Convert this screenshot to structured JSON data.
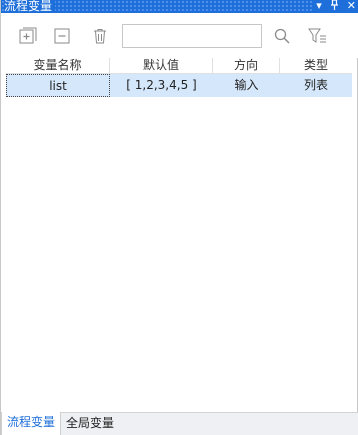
{
  "panel": {
    "title": "流程变量"
  },
  "titlebar_icons": [
    {
      "name": "dropdown-icon",
      "glyph": "▾"
    },
    {
      "name": "pin-icon",
      "glyph": "⊥"
    },
    {
      "name": "close-icon",
      "glyph": "✕"
    }
  ],
  "toolbar": {
    "search_value": "",
    "icons": [
      "add-variable-icon",
      "remove-variable-icon",
      "delete-icon",
      "search-icon",
      "filter-icon"
    ]
  },
  "table": {
    "columns": [
      "变量名称",
      "默认值",
      "方向",
      "类型"
    ],
    "rows": [
      {
        "name": "list",
        "default": "[ 1,2,3,4,5 ]",
        "direction": "输入",
        "type": "列表"
      }
    ]
  },
  "tabs": [
    {
      "label": "流程变量",
      "active": true
    },
    {
      "label": "全局变量",
      "active": false
    }
  ],
  "colors": {
    "accent": "#1e6fd9",
    "selected_row": "#d5e8fb"
  }
}
